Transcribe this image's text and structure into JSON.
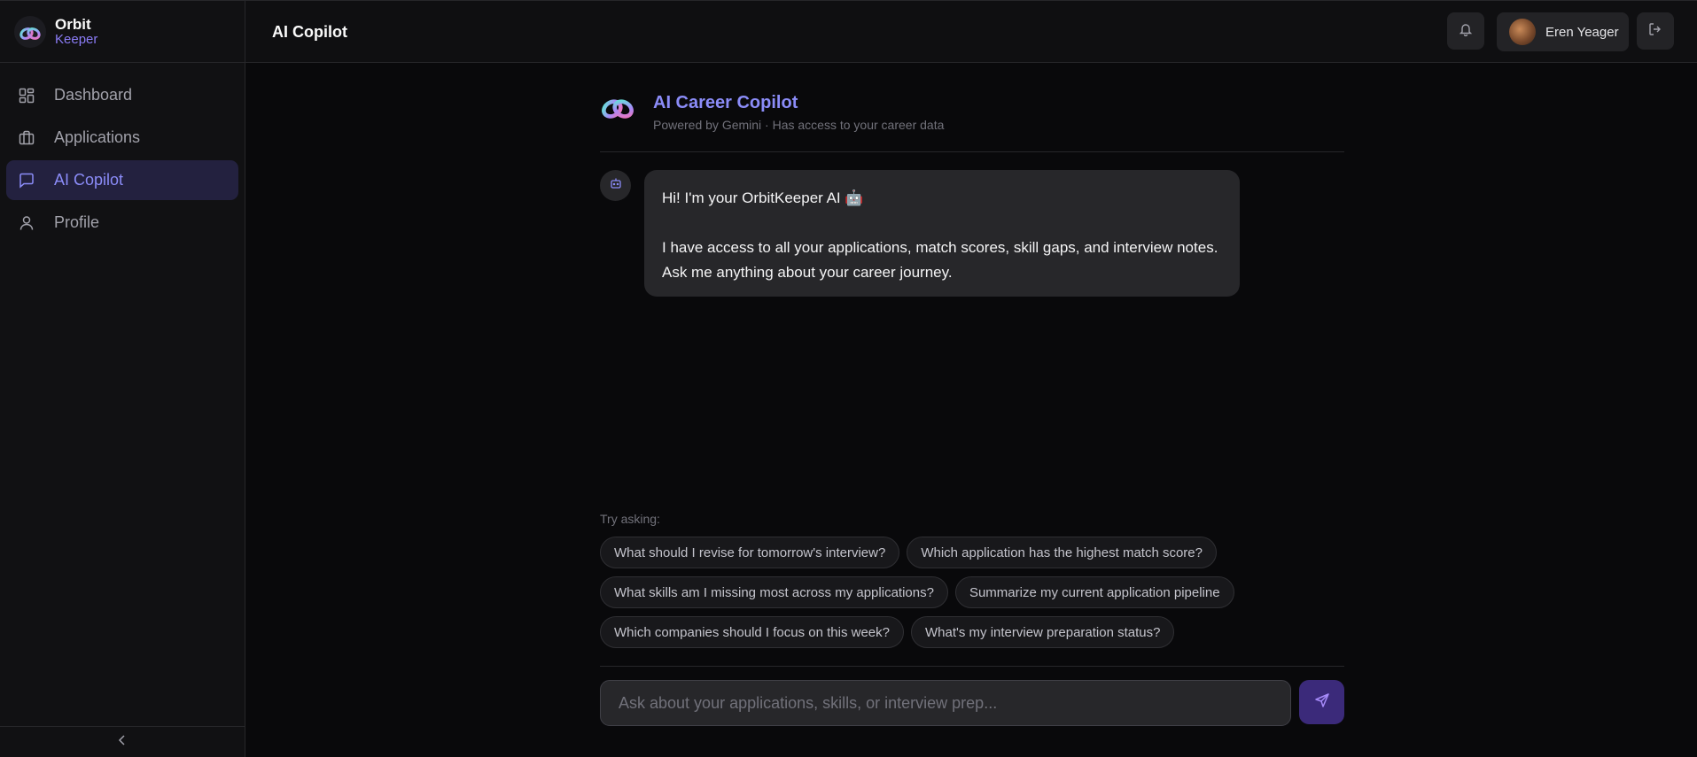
{
  "brand": {
    "name": "Orbit",
    "sub": "Keeper"
  },
  "nav": {
    "items": [
      {
        "label": "Dashboard",
        "icon": "dashboard-icon"
      },
      {
        "label": "Applications",
        "icon": "briefcase-icon"
      },
      {
        "label": "AI Copilot",
        "icon": "chat-icon",
        "active": true
      },
      {
        "label": "Profile",
        "icon": "user-icon"
      }
    ]
  },
  "header": {
    "title": "AI Copilot",
    "user_name": "Eren Yeager"
  },
  "chat": {
    "title": "AI Career Copilot",
    "subtitle": "Powered by Gemini · Has access to your career data",
    "message_line1": "Hi! I'm your OrbitKeeper AI 🤖",
    "message_line2": "I have access to all your applications, match scores, skill gaps, and interview notes. Ask me anything about your career journey.",
    "try_label": "Try asking:",
    "suggestions": [
      "What should I revise for tomorrow's interview?",
      "Which application has the highest match score?",
      "What skills am I missing most across my applications?",
      "Summarize my current application pipeline",
      "Which companies should I focus on this week?",
      "What's my interview preparation status?"
    ],
    "input_placeholder": "Ask about your applications, skills, or interview prep..."
  },
  "colors": {
    "accent": "#8b8cf8",
    "background": "#09090b",
    "surface": "#27272a",
    "send_button": "#3b2a7a"
  }
}
